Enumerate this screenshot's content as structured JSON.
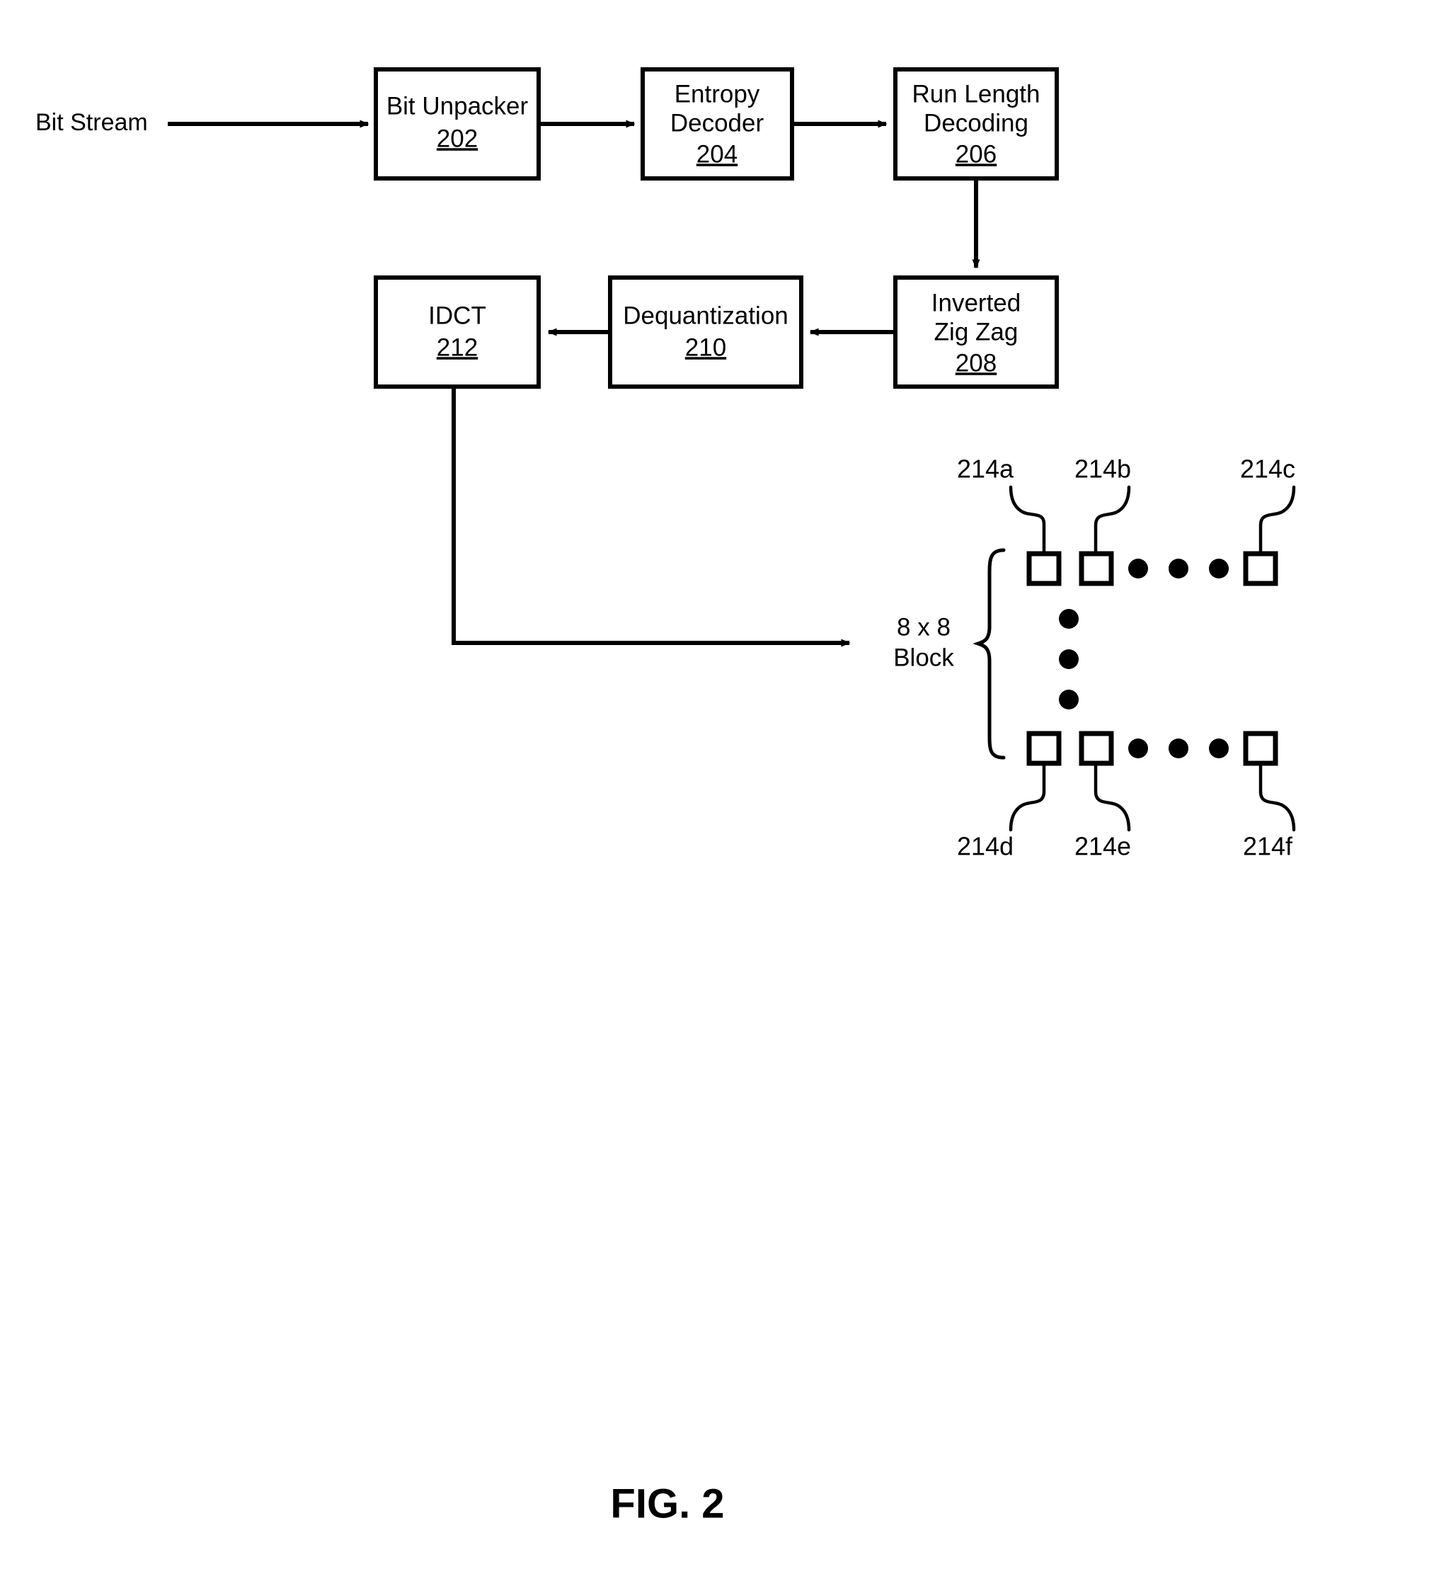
{
  "figure": {
    "caption": "FIG. 2",
    "input_label": "Bit Stream",
    "block_group_label_line1": "8 x 8",
    "block_group_label_line2": "Block"
  },
  "pipeline": {
    "blocks": [
      {
        "id": "bit-unpacker",
        "line1": "Bit Unpacker",
        "line2": "",
        "number": "202"
      },
      {
        "id": "entropy-decoder",
        "line1": "Entropy",
        "line2": "Decoder",
        "number": "204"
      },
      {
        "id": "run-length",
        "line1": "Run Length",
        "line2": "Decoding",
        "number": "206"
      },
      {
        "id": "inverted-zigzag",
        "line1": "Inverted",
        "line2": "Zig Zag",
        "number": "208"
      },
      {
        "id": "dequantization",
        "line1": "Dequantization",
        "line2": "",
        "number": "210"
      },
      {
        "id": "idct",
        "line1": "IDCT",
        "line2": "",
        "number": "212"
      }
    ]
  },
  "block_cells": {
    "top_row": [
      {
        "ref": "214a"
      },
      {
        "ref": "214b"
      },
      {
        "ref": "214c"
      }
    ],
    "bottom_row": [
      {
        "ref": "214d"
      },
      {
        "ref": "214e"
      },
      {
        "ref": "214f"
      }
    ]
  },
  "colors": {
    "ink": "#000000",
    "paper": "#ffffff"
  }
}
